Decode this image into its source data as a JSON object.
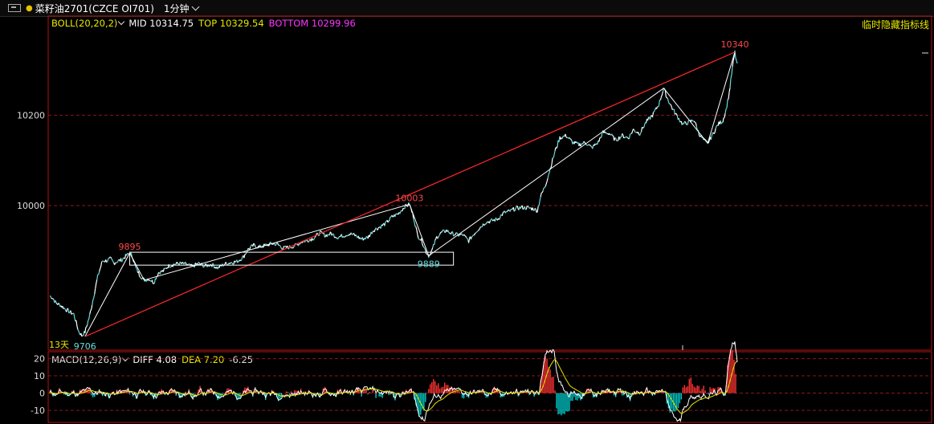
{
  "header": {
    "instrument": "菜籽油2701(CZCE OI701)",
    "period": "1分钟"
  },
  "boll": {
    "name": "BOLL(20,20,2)",
    "mid": "MID 10314.75",
    "top": "TOP 10329.54",
    "bottom": "BOTTOM 10299.96",
    "colors": {
      "name": "#e6e600",
      "mid": "#ffffff",
      "top": "#e6e600",
      "bottom": "#ff33ff"
    }
  },
  "hide_indicator_label": "临时隐藏指标线",
  "macd": {
    "name": "MACD(12,26,9)",
    "diff": "DIFF 4.08",
    "dea": "DEA 7.20",
    "macd": "-6.25",
    "colors": {
      "diff": "#ffffff",
      "dea": "#e6e600",
      "up": "#ff3333",
      "down": "#00cccc"
    }
  },
  "chart_data": {
    "type": "line",
    "title": "",
    "price_axis": {
      "ticks": [
        10200,
        10000
      ],
      "range": [
        9680,
        10370
      ]
    },
    "macd_axis": {
      "ticks": [
        20,
        10,
        0,
        -10
      ],
      "range": [
        -17,
        24
      ]
    },
    "series": [
      {
        "values": [
          [
            0,
            9800
          ],
          [
            3,
            9797
          ],
          [
            8,
            9784
          ],
          [
            13,
            9780
          ],
          [
            18,
            9773
          ],
          [
            22,
            9768
          ],
          [
            25,
            9764
          ],
          [
            30,
            9760
          ],
          [
            36,
            9722
          ],
          [
            40,
            9712
          ],
          [
            44,
            9720
          ],
          [
            50,
            9757
          ],
          [
            55,
            9800
          ],
          [
            60,
            9843
          ],
          [
            66,
            9878
          ],
          [
            72,
            9878
          ],
          [
            76,
            9882
          ],
          [
            80,
            9873
          ],
          [
            85,
            9877
          ],
          [
            90,
            9880
          ],
          [
            95,
            9888
          ],
          [
            100,
            9895
          ],
          [
            104,
            9885
          ],
          [
            108,
            9860
          ],
          [
            112,
            9848
          ],
          [
            118,
            9835
          ],
          [
            124,
            9838
          ],
          [
            130,
            9830
          ],
          [
            136,
            9852
          ],
          [
            142,
            9855
          ],
          [
            148,
            9866
          ],
          [
            155,
            9870
          ],
          [
            162,
            9872
          ],
          [
            170,
            9870
          ],
          [
            178,
            9865
          ],
          [
            186,
            9872
          ],
          [
            194,
            9866
          ],
          [
            202,
            9870
          ],
          [
            210,
            9862
          ],
          [
            218,
            9870
          ],
          [
            226,
            9874
          ],
          [
            234,
            9876
          ],
          [
            242,
            9886
          ],
          [
            248,
            9903
          ],
          [
            255,
            9912
          ],
          [
            262,
            9908
          ],
          [
            270,
            9912
          ],
          [
            278,
            9916
          ],
          [
            285,
            9914
          ],
          [
            292,
            9906
          ],
          [
            300,
            9908
          ],
          [
            308,
            9912
          ],
          [
            315,
            9920
          ],
          [
            322,
            9923
          ],
          [
            330,
            9928
          ],
          [
            338,
            9940
          ],
          [
            345,
            9934
          ],
          [
            352,
            9938
          ],
          [
            360,
            9930
          ],
          [
            368,
            9934
          ],
          [
            375,
            9938
          ],
          [
            382,
            9934
          ],
          [
            390,
            9926
          ],
          [
            398,
            9930
          ],
          [
            405,
            9946
          ],
          [
            412,
            9952
          ],
          [
            420,
            9960
          ],
          [
            428,
            9975
          ],
          [
            436,
            9982
          ],
          [
            444,
            9998
          ],
          [
            450,
            10003
          ],
          [
            455,
            9975
          ],
          [
            460,
            9935
          ],
          [
            466,
            9920
          ],
          [
            470,
            9900
          ],
          [
            474,
            9889
          ],
          [
            478,
            9900
          ],
          [
            484,
            9930
          ],
          [
            490,
            9940
          ],
          [
            496,
            9945
          ],
          [
            503,
            9938
          ],
          [
            510,
            9935
          ],
          [
            517,
            9935
          ],
          [
            524,
            9922
          ],
          [
            530,
            9936
          ],
          [
            537,
            9950
          ],
          [
            545,
            9963
          ],
          [
            552,
            9966
          ],
          [
            560,
            9970
          ],
          [
            568,
            9984
          ],
          [
            575,
            9987
          ],
          [
            582,
            9993
          ],
          [
            590,
            9996
          ],
          [
            598,
            9995
          ],
          [
            605,
            9993
          ],
          [
            610,
            9989
          ],
          [
            614,
            10020
          ],
          [
            620,
            10045
          ],
          [
            626,
            10082
          ],
          [
            632,
            10120
          ],
          [
            638,
            10150
          ],
          [
            646,
            10155
          ],
          [
            654,
            10140
          ],
          [
            662,
            10135
          ],
          [
            670,
            10140
          ],
          [
            678,
            10128
          ],
          [
            686,
            10140
          ],
          [
            692,
            10162
          ],
          [
            700,
            10160
          ],
          [
            708,
            10145
          ],
          [
            716,
            10155
          ],
          [
            724,
            10150
          ],
          [
            730,
            10168
          ],
          [
            738,
            10160
          ],
          [
            746,
            10185
          ],
          [
            754,
            10200
          ],
          [
            762,
            10225
          ],
          [
            768,
            10260
          ],
          [
            772,
            10240
          ],
          [
            778,
            10218
          ],
          [
            784,
            10200
          ],
          [
            792,
            10180
          ],
          [
            800,
            10185
          ],
          [
            806,
            10190
          ],
          [
            812,
            10160
          ],
          [
            818,
            10145
          ],
          [
            823,
            10138
          ],
          [
            830,
            10160
          ],
          [
            836,
            10180
          ],
          [
            842,
            10188
          ],
          [
            846,
            10212
          ],
          [
            850,
            10250
          ],
          [
            854,
            10305
          ],
          [
            857,
            10340
          ],
          [
            860,
            10310
          ]
        ]
      }
    ]
  }
}
